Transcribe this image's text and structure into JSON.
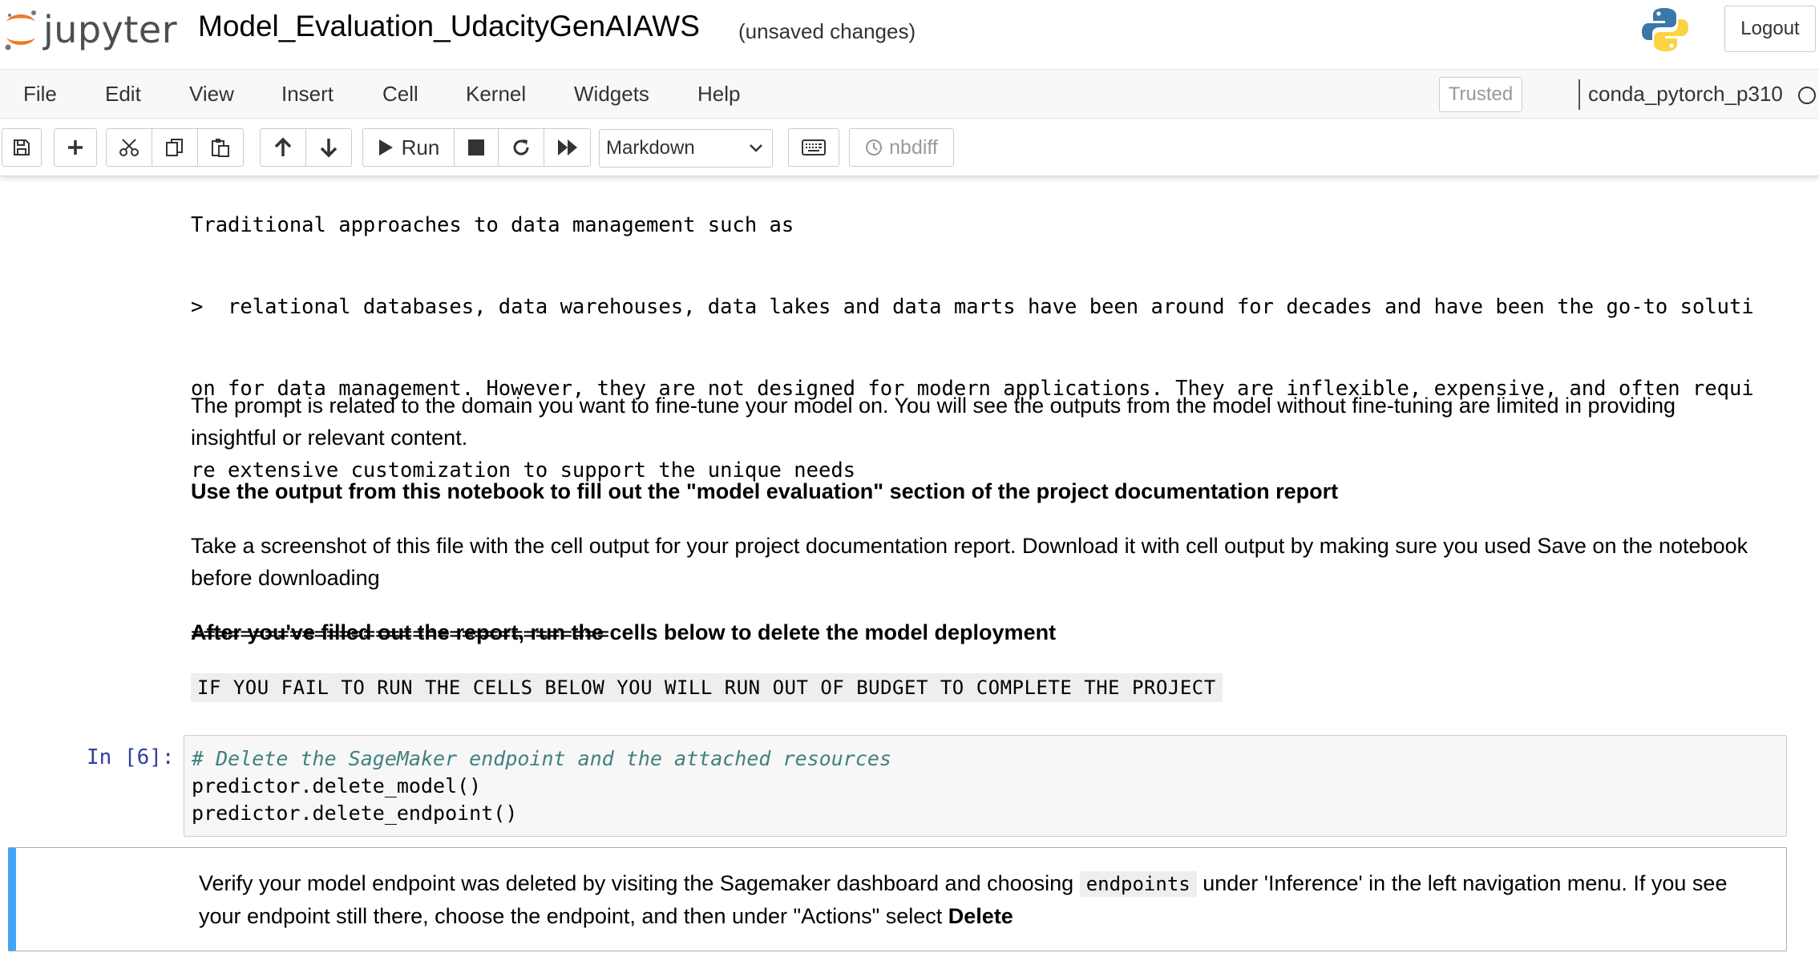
{
  "header": {
    "logo_text": "jupyter",
    "notebook_title": "Model_Evaluation_UdacityGenAIAWS",
    "save_status": "(unsaved changes)",
    "logout_label": "Logout"
  },
  "menubar": {
    "items": [
      "File",
      "Edit",
      "View",
      "Insert",
      "Cell",
      "Kernel",
      "Widgets",
      "Help"
    ],
    "trusted_label": "Trusted",
    "kernel_name": "conda_pytorch_p310"
  },
  "toolbar": {
    "run_label": "Run",
    "cell_type": "Markdown",
    "nbdiff_label": "nbdiff",
    "icons": [
      "save-icon",
      "plus-icon",
      "cut-icon",
      "copy-icon",
      "paste-icon",
      "arrow-up-icon",
      "arrow-down-icon",
      "play-icon",
      "stop-icon",
      "restart-icon",
      "fast-forward-icon",
      "keyboard-icon",
      "history-icon"
    ]
  },
  "notebook": {
    "output_text": {
      "line0": "Traditional approaches to data management such as",
      "line1": ">  relational databases, data warehouses, data lakes and data marts have been around for decades and have been the go-to soluti",
      "line2": "on for data management. However, they are not designed for modern applications. They are inflexible, expensive, and often requi",
      "line3": "re extensive customization to support the unique needs",
      "separator": "=================================="
    },
    "markdown": {
      "p1": "The prompt is related to the domain you want to fine-tune your model on. You will see the outputs from the model without fine-tuning are limited in providing insightful or relevant content.",
      "p2": "Use the output from this notebook to fill out the \"model evaluation\" section of the project documentation report",
      "p3": "Take a screenshot of this file with the cell output for your project documentation report. Download it with cell output by making sure you used Save on the notebook before downloading",
      "p4": "After you've filled out the report, run the cells below to delete the model deployment",
      "warning_code": "IF YOU FAIL TO RUN THE CELLS BELOW YOU WILL RUN OUT OF BUDGET TO COMPLETE THE PROJECT"
    },
    "code_cell": {
      "prompt": "In [6]:",
      "comment": "# Delete the SageMaker endpoint and the attached resources",
      "line2": "predictor.delete_model()",
      "line3": "predictor.delete_endpoint()"
    },
    "selected_cell": {
      "text_before": "Verify your model endpoint was deleted by visiting the Sagemaker dashboard and choosing ",
      "inline_code": "endpoints",
      "text_after": " under 'Inference' in the left navigation menu. If you see your endpoint still there, choose the endpoint, and then under \"Actions\" select ",
      "bold_word": "Delete"
    }
  },
  "colors": {
    "accent_selected": "#42a5f5",
    "prompt_blue": "#303f9f",
    "jupyter_orange": "#f37726",
    "comment_teal": "#408080"
  }
}
